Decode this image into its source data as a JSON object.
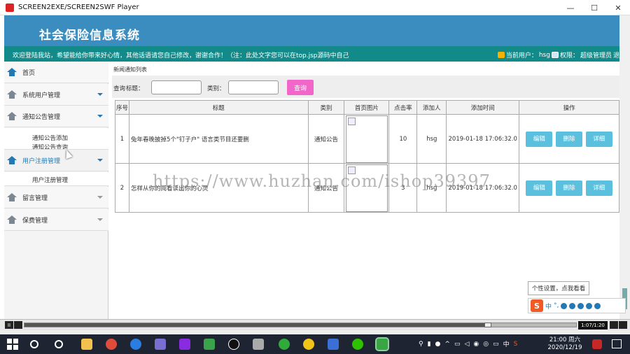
{
  "window": {
    "title": "SCREEN2EXE/SCREEN2SWF Player",
    "minimize": "—",
    "maximize": "☐",
    "close": "✕"
  },
  "app": {
    "title": "社会保险信息系统",
    "marquee": "欢迎登陆我站，希望能给你带来好心情，其他话语请您自己修改，谢谢合作！（注：此处文字您可以在top.jsp源码中自己",
    "user_label": "当前用户：",
    "user_name": "hsg",
    "role_label": "权限：",
    "role_name": "超级管理员",
    "exit_label": "退"
  },
  "sidebar": {
    "home": "首页",
    "items": [
      {
        "label": "系统用户管理"
      },
      {
        "label": "通知公告管理"
      },
      {
        "label": "用户注册管理"
      },
      {
        "label": "留言管理"
      },
      {
        "label": "保费管理"
      }
    ],
    "notice_subs": [
      "通知公告添加",
      "通知公告查询"
    ],
    "register_subs": [
      "用户注册管理"
    ]
  },
  "content": {
    "breadcrumb": "新闻通知列表",
    "filter": {
      "query_label": "查询",
      "title_label": "标题：",
      "category_label": "类别：",
      "search_button": "查询"
    },
    "table": {
      "headers": [
        "序号",
        "标题",
        "类别",
        "首页图片",
        "点击率",
        "添加人",
        "添加时间",
        "操作"
      ],
      "rows": [
        {
          "index": "1",
          "title": "兔年春晚披掉5个\"钉子户\" 语言类节目还要删",
          "category": "通知公告",
          "clicks": "10",
          "author": "hsg",
          "time": "2019-01-18 17:06:32.0"
        },
        {
          "index": "2",
          "title": "怎样从你的阅看读出你的心灵",
          "category": "通知公告",
          "clicks": "3",
          "author": "hsg",
          "time": "2019-01-18 17:06:32.0"
        }
      ],
      "actions": {
        "edit": "编辑",
        "delete": "删除",
        "detail": "详细"
      }
    }
  },
  "watermark": "https://www.huzhan.com/ishop39397",
  "tooltip": "个性设置，点我看看",
  "ime": {
    "logo": "S",
    "mode": "中",
    "punct": "°,"
  },
  "player": {
    "pause": "II",
    "time": "1:07/1:20",
    "progress": 0.84
  },
  "taskbar": {
    "lang": "中",
    "time": "21:00 周六",
    "date": "2020/12/19"
  },
  "colors": {
    "header": "#3b8dbf",
    "notice_bar": "#138a8a",
    "search_button": "#f366c9",
    "action_button": "#5bc0de"
  }
}
